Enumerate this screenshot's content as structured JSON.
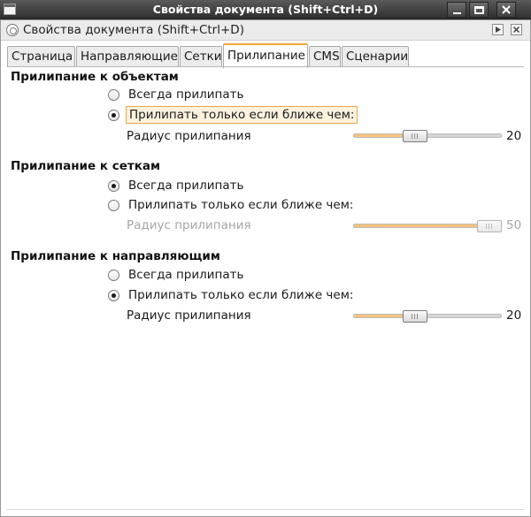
{
  "window": {
    "title": "Свойства документа (Shift+Ctrl+D)"
  },
  "dock": {
    "title": "Свойства документа (Shift+Ctrl+D)"
  },
  "tabs": [
    {
      "label": "Страница",
      "active": false
    },
    {
      "label": "Направляющие",
      "active": false
    },
    {
      "label": "Сетки",
      "active": false
    },
    {
      "label": "Прилипание",
      "active": true
    },
    {
      "label": "CMS",
      "active": false
    },
    {
      "label": "Сценарии",
      "active": false
    }
  ],
  "sections": {
    "objects": {
      "title": "Прилипание к объектам",
      "always_label": "Всегда прилипать",
      "only_if_closer_label": "Прилипать только если ближе чем:",
      "selected": "only_if_closer",
      "radius_label": "Радиус прилипания",
      "radius_value": "20",
      "radius_fraction": 0.4,
      "slider_enabled": true
    },
    "grids": {
      "title": "Прилипание к сеткам",
      "always_label": "Всегда прилипать",
      "only_if_closer_label": "Прилипать только если ближе чем:",
      "selected": "always",
      "radius_label": "Радиус прилипания",
      "radius_value": "50",
      "radius_fraction": 1.0,
      "slider_enabled": false
    },
    "guides": {
      "title": "Прилипание к направляющим",
      "always_label": "Всегда прилипать",
      "only_if_closer_label": "Прилипать только если ближе чем:",
      "selected": "only_if_closer",
      "radius_label": "Радиус прилипания",
      "radius_value": "20",
      "radius_fraction": 0.4,
      "slider_enabled": true
    }
  },
  "colors": {
    "accent": "#f0a42c",
    "slider_fill": "#f6c47d",
    "titlebar": "#3c3c3c"
  },
  "icons": {
    "window_menu": "window-menu-icon",
    "minimize": "minimize-icon",
    "maximize": "maximize-icon",
    "close": "close-icon",
    "dock": "document-properties-icon",
    "dock_play": "dock-play-icon",
    "dock_close": "dock-close-icon"
  }
}
